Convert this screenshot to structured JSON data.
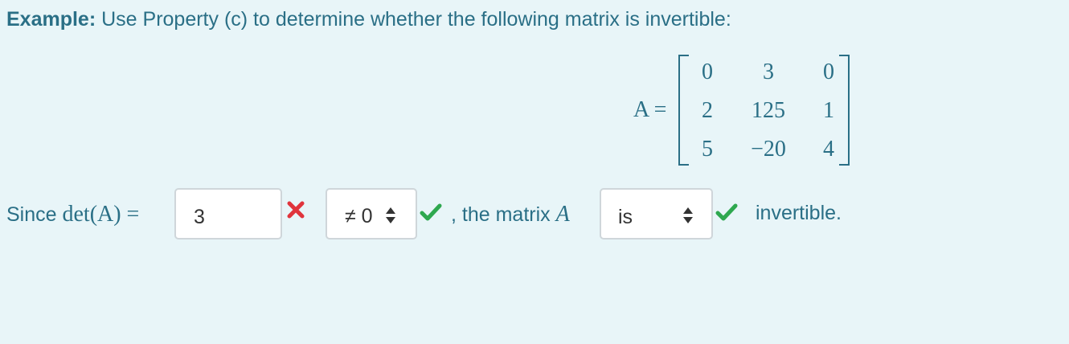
{
  "prompt": {
    "label": "Example:",
    "text": " Use Property (c) to determine whether the following matrix is invertible:"
  },
  "matrix": {
    "lhs": "A =",
    "rows": [
      [
        "0",
        "3",
        "0"
      ],
      [
        "2",
        "125",
        "1"
      ],
      [
        "5",
        "−20",
        "4"
      ]
    ]
  },
  "answer": {
    "since_text": "Since ",
    "det_expr": "det(A) =",
    "det_value": "3",
    "det_status": "incorrect",
    "comparison_selected": "≠ 0",
    "comparison_status": "correct",
    "middle_text": ", the matrix ",
    "middle_var": "A",
    "is_selected": "is",
    "is_status": "correct",
    "end_text": "invertible."
  },
  "colors": {
    "text": "#2a6f86",
    "background": "#e8f5f8",
    "incorrect": "#e0343c",
    "correct": "#2ea84f"
  }
}
